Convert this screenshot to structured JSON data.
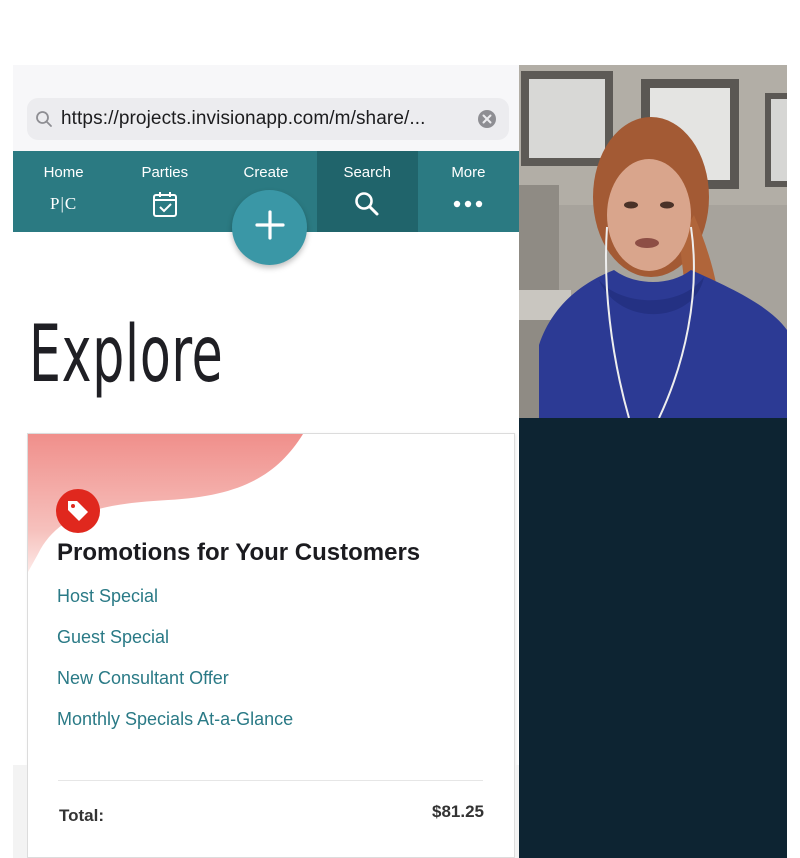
{
  "browser": {
    "url": "https://projects.invisionapp.com/m/share/..."
  },
  "nav": {
    "items": [
      {
        "label": "Home",
        "icon": "pc-logo-icon",
        "logo_text": "P|C"
      },
      {
        "label": "Parties",
        "icon": "calendar-check-icon"
      },
      {
        "label": "Create",
        "icon": "plus-icon"
      },
      {
        "label": "Search",
        "icon": "search-icon"
      },
      {
        "label": "More",
        "icon": "more-dots-icon"
      }
    ],
    "active": "Search"
  },
  "page": {
    "title": "Explore"
  },
  "promotions": {
    "title": "Promotions for Your Customers",
    "links": [
      "Host Special",
      "Guest Special",
      "New Consultant Offer",
      "Monthly Specials At-a-Glance"
    ]
  },
  "summary": {
    "total_label": "Total:",
    "total_value": "$81.25"
  },
  "colors": {
    "nav_bg": "#2b7a82",
    "nav_active": "#20646b",
    "fab": "#3a97a6",
    "link": "#2a7a86",
    "promo_red": "#e0281e",
    "dark_panel": "#0d2432"
  }
}
